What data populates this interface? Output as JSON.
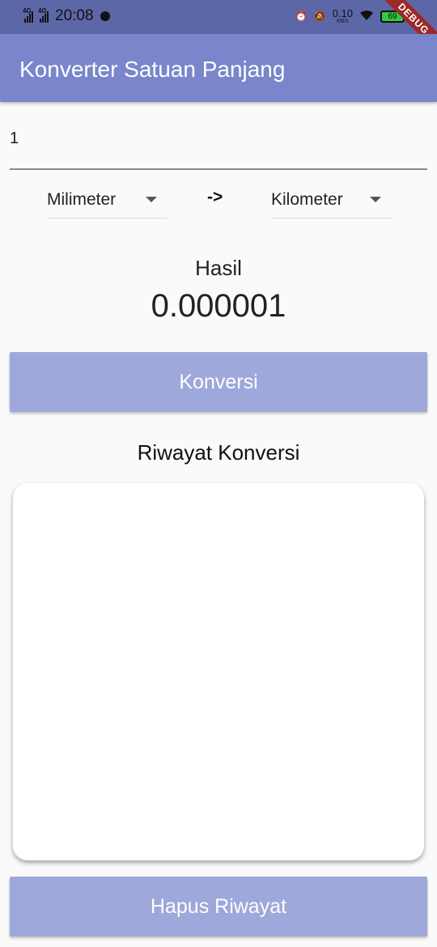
{
  "status_bar": {
    "network_1": "4G",
    "network_2": "4G",
    "time": "20:08",
    "speed_value": "0.10",
    "speed_unit": "KB/s",
    "battery_level": "69",
    "debug_banner": "DEBUG"
  },
  "app_bar": {
    "title": "Konverter Satuan Panjang",
    "color": "#7986cb"
  },
  "converter": {
    "input_value": "1",
    "from_unit": "Milimeter",
    "arrow": "->",
    "to_unit": "Kilometer",
    "result_label": "Hasil",
    "result_value": "0.000001",
    "convert_label": "Konversi"
  },
  "history": {
    "title": "Riwayat Konversi",
    "items": [],
    "clear_label": "Hapus Riwayat"
  },
  "colors": {
    "button": "#9fa8da",
    "status_bar": "#5c67a7"
  }
}
